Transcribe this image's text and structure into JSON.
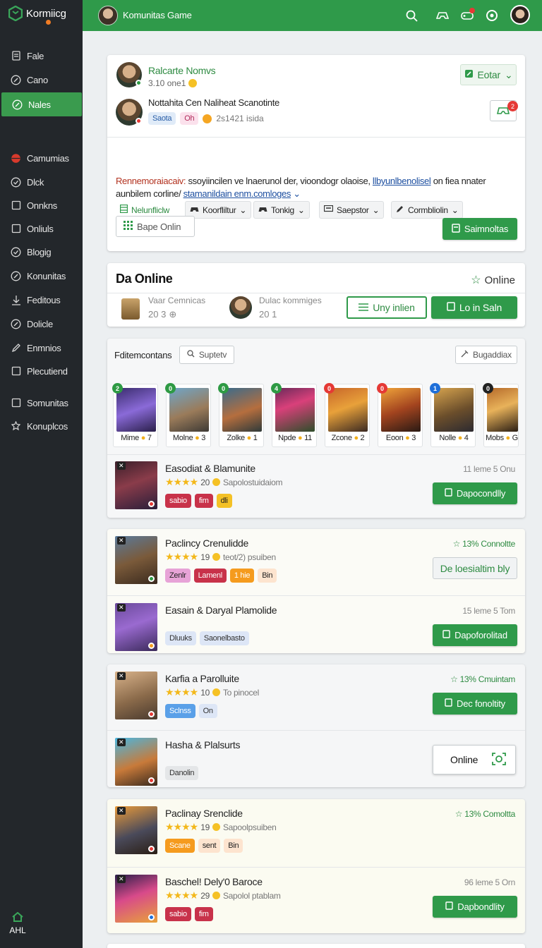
{
  "sidebar": {
    "logo": "Kormiicg",
    "items": [
      {
        "label": "Fale",
        "icon": "page-icon"
      },
      {
        "label": "Cano",
        "icon": "compass-icon"
      },
      {
        "label": "Nales",
        "icon": "compass-icon",
        "active": true
      },
      {
        "label": "Camumias",
        "icon": "globe-icon"
      },
      {
        "label": "Dlck",
        "icon": "check-circle-icon"
      },
      {
        "label": "Onnkns",
        "icon": "square-icon"
      },
      {
        "label": "Onliuls",
        "icon": "square-icon"
      },
      {
        "label": "Blogig",
        "icon": "check-circle-icon"
      },
      {
        "label": "Konunitas",
        "icon": "compass-icon"
      },
      {
        "label": "Feditous",
        "icon": "download-icon"
      },
      {
        "label": "Dolicle",
        "icon": "compass-icon"
      },
      {
        "label": "Enmnios",
        "icon": "pen-icon"
      },
      {
        "label": "Plecutiend",
        "icon": "square-icon"
      },
      {
        "label": "Somunitas",
        "icon": "square-icon"
      },
      {
        "label": "Konuplcos",
        "icon": "gear-icon"
      }
    ],
    "footer_label": "AHL"
  },
  "topbar": {
    "title": "Komunitas Game",
    "icons": [
      "search-icon",
      "gamepad-icon",
      "controller-icon",
      "settings-icon"
    ]
  },
  "profile_card": {
    "name": "Ralcarte Nomvs",
    "status": "3.10 one1",
    "edit_button": "Eotar",
    "post_title": "Nottahita Cen Naliheat Scanotinte",
    "tag1": "Saota",
    "tag2": "Oh",
    "meta": "2s1421 isida",
    "filters": [
      {
        "label": "Nelunfliclw",
        "icon": "grid-icon"
      },
      {
        "label": "Koorfliltur",
        "icon": "gamepad-icon"
      },
      {
        "label": "Tonkig",
        "icon": "gamepad-icon"
      },
      {
        "label": "Saepstor",
        "icon": "monitor-icon"
      },
      {
        "label": "Cormbliolin",
        "icon": "pen-icon"
      }
    ],
    "description_lead": "Rennemoraiacaiv:",
    "description_body": " ssoyiincilen ve lnaerunol der, vioondogr olaoise, ",
    "description_link1": "llbyunlbenolisel",
    "description_mid": " on fiea nnater",
    "description_line2": "aunbilem corline/ ",
    "description_link2": "stamanildain enm.comloges",
    "badge_button": "Bape Onlin",
    "save_button": "Saimnoltas"
  },
  "online_card": {
    "title": "Da Online",
    "status": "Online",
    "user1_label": "Vaar Cemnicas",
    "user1_count": "20 3",
    "user2_label": "Dulac kommiges",
    "user2_count": "20 1",
    "btn_outline": "Uny inlien",
    "btn_green": "Lo in Saln"
  },
  "games_card": {
    "header_label": "Fditemcontans",
    "search_placeholder": "Suptetv",
    "filter_button": "Bugaddiax",
    "minis": [
      {
        "name": "Mime",
        "count": "7",
        "badge": "2",
        "badge_color": "#2e9a44"
      },
      {
        "name": "Molne",
        "count": "3",
        "badge": "0",
        "badge_color": "#2e9a44"
      },
      {
        "name": "Zolke",
        "count": "1",
        "badge": "0",
        "badge_color": "#2e9a44"
      },
      {
        "name": "Npde",
        "count": "11",
        "badge": "4",
        "badge_color": "#2e9a44"
      },
      {
        "name": "Zcone",
        "count": "2",
        "badge": "0",
        "badge_color": "#e53935"
      },
      {
        "name": "Eoon",
        "count": "3",
        "badge": "0",
        "badge_color": "#e53935"
      },
      {
        "name": "Nolle",
        "count": "4",
        "badge": "1",
        "badge_color": "#1e6fd9"
      },
      {
        "name": "Mobs",
        "count": "G",
        "badge": "0",
        "badge_color": "#222"
      }
    ]
  },
  "rows": [
    {
      "title": "Easodiat & Blamunite",
      "rating": "20",
      "sub": "Sapolostuidaiom",
      "meta": "11 leme 5 Onu",
      "meta_green": false,
      "button": "Dapocondlly",
      "button_style": "green",
      "tags": [
        {
          "t": "sabio",
          "bg": "#c8324a",
          "fg": "#fff"
        },
        {
          "t": "fim",
          "bg": "#c8324a",
          "fg": "#fff"
        },
        {
          "t": "dli",
          "bg": "#f4c126",
          "fg": "#222"
        }
      ]
    },
    {
      "title": "Paclincy Crenulidde",
      "rating": "19",
      "sub": "teot/2) psuiben",
      "meta": "13% Connoltte",
      "meta_green": true,
      "button": "De loesialtim bly",
      "button_style": "outline",
      "tags": [
        {
          "t": "Zenlr",
          "bg": "#e7a3d7",
          "fg": "#222"
        },
        {
          "t": "Lamenl",
          "bg": "#c8324a",
          "fg": "#fff"
        },
        {
          "t": "1 hie",
          "bg": "#f59b1e",
          "fg": "#fff"
        },
        {
          "t": "Bin",
          "bg": "#fde4cf",
          "fg": "#222"
        }
      ]
    },
    {
      "title": "Easain & Daryal Plamolide",
      "rating": "",
      "sub": "",
      "meta": "15 leme 5 Tom",
      "meta_green": false,
      "button": "Dapoforolitad",
      "button_style": "green",
      "tags": [
        {
          "t": "Dluuks",
          "bg": "#dde6f6",
          "fg": "#333"
        },
        {
          "t": "Saonelbasto",
          "bg": "#dde6f6",
          "fg": "#333"
        }
      ]
    },
    {
      "title": "Karfia a Parolluite",
      "rating": "10",
      "sub": "To pinocel",
      "meta": "13% Cmuintam",
      "meta_green": true,
      "button": "Dec fonoltity",
      "button_style": "green",
      "tags": [
        {
          "t": "Sclnss",
          "bg": "#5aa0e8",
          "fg": "#fff"
        },
        {
          "t": "On",
          "bg": "#dde6f6",
          "fg": "#333"
        }
      ]
    },
    {
      "title": "Hasha & Plalsurts",
      "rating": "",
      "sub": "",
      "meta": "",
      "meta_green": false,
      "button": "Online",
      "button_style": "online",
      "tags": [
        {
          "t": "Danolin",
          "bg": "#e4e6e8",
          "fg": "#333"
        }
      ]
    },
    {
      "title": "Paclinay Srenclide",
      "rating": "19",
      "sub": "Sapoolpsuiben",
      "meta": "13% Comoltta",
      "meta_green": true,
      "button": "",
      "button_style": "none",
      "tags": [
        {
          "t": "Scane",
          "bg": "#f59b1e",
          "fg": "#fff"
        },
        {
          "t": "sent",
          "bg": "#fde4cf",
          "fg": "#222"
        },
        {
          "t": "Bin",
          "bg": "#fde4cf",
          "fg": "#222"
        }
      ]
    },
    {
      "title": "Baschel! Dely'0 Baroce",
      "rating": "29",
      "sub": "Sapolol ptablam",
      "meta": "96 leme 5 Orn",
      "meta_green": false,
      "button": "Dapbondlity",
      "button_style": "green",
      "tags": [
        {
          "t": "sabio",
          "bg": "#c8324a",
          "fg": "#fff"
        },
        {
          "t": "fim",
          "bg": "#c8324a",
          "fg": "#fff"
        }
      ]
    }
  ]
}
